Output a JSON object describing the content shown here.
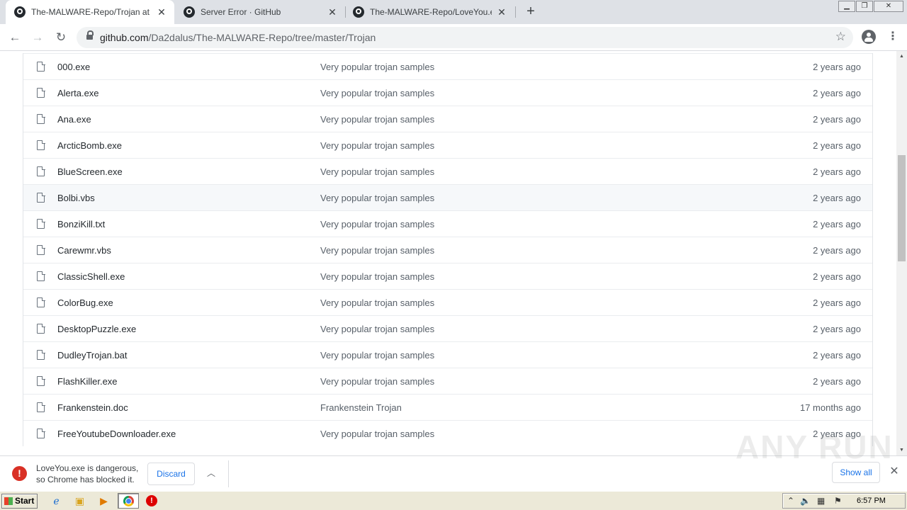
{
  "browser": {
    "tabs": [
      {
        "title": "The-MALWARE-Repo/Trojan at mast",
        "active": true
      },
      {
        "title": "Server Error · GitHub",
        "active": false
      },
      {
        "title": "The-MALWARE-Repo/LoveYou.exe a",
        "active": false
      }
    ],
    "new_tab": "+",
    "url_host": "github.com",
    "url_path": "/Da2dalus/The-MALWARE-Repo/tree/master/Trojan"
  },
  "files": [
    {
      "name": "000.exe",
      "message": "Very popular trojan samples",
      "age": "2 years ago"
    },
    {
      "name": "Alerta.exe",
      "message": "Very popular trojan samples",
      "age": "2 years ago"
    },
    {
      "name": "Ana.exe",
      "message": "Very popular trojan samples",
      "age": "2 years ago"
    },
    {
      "name": "ArcticBomb.exe",
      "message": "Very popular trojan samples",
      "age": "2 years ago"
    },
    {
      "name": "BlueScreen.exe",
      "message": "Very popular trojan samples",
      "age": "2 years ago"
    },
    {
      "name": "Bolbi.vbs",
      "message": "Very popular trojan samples",
      "age": "2 years ago",
      "hover": true
    },
    {
      "name": "BonziKill.txt",
      "message": "Very popular trojan samples",
      "age": "2 years ago"
    },
    {
      "name": "Carewmr.vbs",
      "message": "Very popular trojan samples",
      "age": "2 years ago"
    },
    {
      "name": "ClassicShell.exe",
      "message": "Very popular trojan samples",
      "age": "2 years ago"
    },
    {
      "name": "ColorBug.exe",
      "message": "Very popular trojan samples",
      "age": "2 years ago"
    },
    {
      "name": "DesktopPuzzle.exe",
      "message": "Very popular trojan samples",
      "age": "2 years ago"
    },
    {
      "name": "DudleyTrojan.bat",
      "message": "Very popular trojan samples",
      "age": "2 years ago"
    },
    {
      "name": "FlashKiller.exe",
      "message": "Very popular trojan samples",
      "age": "2 years ago"
    },
    {
      "name": "Frankenstein.doc",
      "message": "Frankenstein Trojan",
      "age": "17 months ago"
    },
    {
      "name": "FreeYoutubeDownloader.exe",
      "message": "Very popular trojan samples",
      "age": "2 years ago"
    }
  ],
  "download_bar": {
    "line1": "LoveYou.exe is dangerous,",
    "line2": "so Chrome has blocked it.",
    "discard_label": "Discard",
    "show_all_label": "Show all",
    "watermark": "ANY RUN"
  },
  "taskbar": {
    "start_label": "Start",
    "clock": "6:57 PM"
  }
}
